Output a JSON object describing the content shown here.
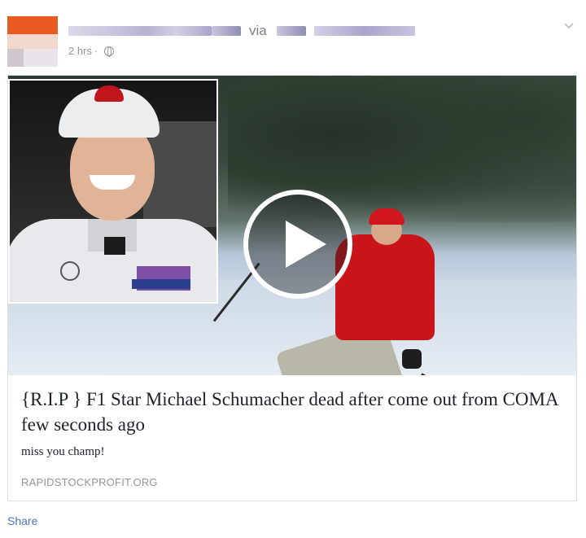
{
  "post": {
    "via_label": "via",
    "timestamp": "2 hrs",
    "separator": "·",
    "privacy_icon": "globe-icon",
    "menu_icon": "chevron-down-icon"
  },
  "link": {
    "title": "{R.I.P } F1 Star Michael Schumacher dead after come out from COMA few seconds ago",
    "description": "miss you champ!",
    "domain": "RAPIDSTOCKPROFIT.ORG",
    "video_icon": "play-icon"
  },
  "actions": {
    "share_label": "Share"
  },
  "colors": {
    "link_blue": "#4b72c4",
    "meta_gray": "#90949c",
    "border": "#dddfe2"
  }
}
